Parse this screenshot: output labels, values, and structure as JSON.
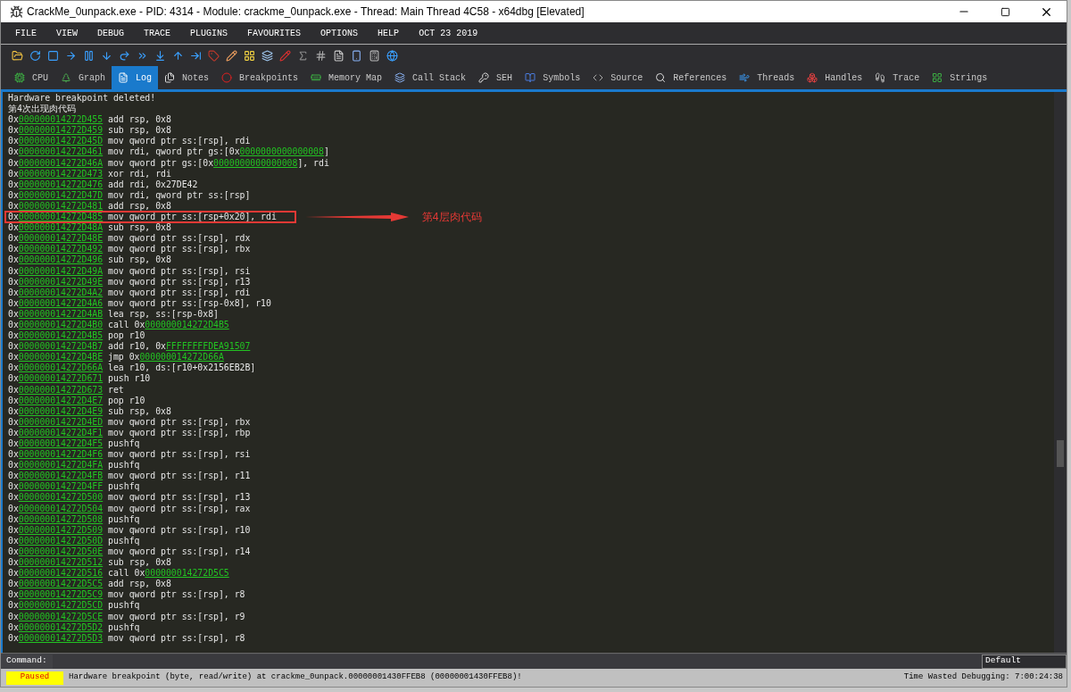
{
  "window": {
    "title": "CrackMe_0unpack.exe - PID: 4314 - Module: crackme_0unpack.exe - Thread: Main Thread 4C58 - x64dbg [Elevated]"
  },
  "menu": [
    "FILE",
    "VIEW",
    "DEBUG",
    "TRACE",
    "PLUGINS",
    "FAVOURITES",
    "OPTIONS",
    "HELP",
    "OCT 23 2019"
  ],
  "tabs": [
    {
      "label": "CPU",
      "selected": false
    },
    {
      "label": "Graph",
      "selected": false
    },
    {
      "label": "Log",
      "selected": true
    },
    {
      "label": "Notes",
      "selected": false
    },
    {
      "label": "Breakpoints",
      "selected": false
    },
    {
      "label": "Memory Map",
      "selected": false
    },
    {
      "label": "Call Stack",
      "selected": false
    },
    {
      "label": "SEH",
      "selected": false
    },
    {
      "label": "Symbols",
      "selected": false
    },
    {
      "label": "Source",
      "selected": false
    },
    {
      "label": "References",
      "selected": false
    },
    {
      "label": "Threads",
      "selected": false
    },
    {
      "label": "Handles",
      "selected": false
    },
    {
      "label": "Trace",
      "selected": false
    },
    {
      "label": "Strings",
      "selected": false
    }
  ],
  "log": {
    "lines": [
      {
        "parts": [
          {
            "kind": "plain",
            "text": "Hardware breakpoint deleted!"
          }
        ]
      },
      {
        "parts": [
          {
            "kind": "plain",
            "text": "第4次出现肉代码"
          }
        ]
      },
      {
        "parts": [
          {
            "kind": "plain",
            "text": "0x"
          },
          {
            "kind": "link",
            "text": "000000014272D455"
          },
          {
            "kind": "plain",
            "text": " add rsp, 0x8"
          }
        ]
      },
      {
        "parts": [
          {
            "kind": "plain",
            "text": "0x"
          },
          {
            "kind": "link",
            "text": "000000014272D459"
          },
          {
            "kind": "plain",
            "text": " sub rsp, 0x8"
          }
        ]
      },
      {
        "parts": [
          {
            "kind": "plain",
            "text": "0x"
          },
          {
            "kind": "link",
            "text": "000000014272D45D"
          },
          {
            "kind": "plain",
            "text": " mov qword ptr ss:[rsp], rdi"
          }
        ]
      },
      {
        "parts": [
          {
            "kind": "plain",
            "text": "0x"
          },
          {
            "kind": "link",
            "text": "000000014272D461"
          },
          {
            "kind": "plain",
            "text": " mov rdi, qword ptr gs:[0x"
          },
          {
            "kind": "link",
            "text": "0000000000000008"
          },
          {
            "kind": "plain",
            "text": "]"
          }
        ]
      },
      {
        "parts": [
          {
            "kind": "plain",
            "text": "0x"
          },
          {
            "kind": "link",
            "text": "000000014272D46A"
          },
          {
            "kind": "plain",
            "text": " mov qword ptr gs:[0x"
          },
          {
            "kind": "link",
            "text": "0000000000000008"
          },
          {
            "kind": "plain",
            "text": "], rdi"
          }
        ]
      },
      {
        "parts": [
          {
            "kind": "plain",
            "text": "0x"
          },
          {
            "kind": "link",
            "text": "000000014272D473"
          },
          {
            "kind": "plain",
            "text": " xor rdi, rdi"
          }
        ]
      },
      {
        "parts": [
          {
            "kind": "plain",
            "text": "0x"
          },
          {
            "kind": "link",
            "text": "000000014272D476"
          },
          {
            "kind": "plain",
            "text": " add rdi, 0x27DE42"
          }
        ]
      },
      {
        "parts": [
          {
            "kind": "plain",
            "text": "0x"
          },
          {
            "kind": "link",
            "text": "000000014272D47D"
          },
          {
            "kind": "plain",
            "text": " mov rdi, qword ptr ss:[rsp]"
          }
        ]
      },
      {
        "parts": [
          {
            "kind": "plain",
            "text": "0x"
          },
          {
            "kind": "link",
            "text": "000000014272D481"
          },
          {
            "kind": "plain",
            "text": " add rsp, 0x8"
          }
        ]
      },
      {
        "parts": [
          {
            "kind": "plain",
            "text": "0x"
          },
          {
            "kind": "link",
            "text": "000000014272D485"
          },
          {
            "kind": "plain",
            "text": " mov qword ptr ss:[rsp+0x20], rdi"
          }
        ],
        "highlighted": true,
        "annotation": "第4层肉代码"
      },
      {
        "parts": [
          {
            "kind": "plain",
            "text": "0x"
          },
          {
            "kind": "link",
            "text": "000000014272D48A"
          },
          {
            "kind": "plain",
            "text": " sub rsp, 0x8"
          }
        ]
      },
      {
        "parts": [
          {
            "kind": "plain",
            "text": "0x"
          },
          {
            "kind": "link",
            "text": "000000014272D48E"
          },
          {
            "kind": "plain",
            "text": " mov qword ptr ss:[rsp], rdx"
          }
        ]
      },
      {
        "parts": [
          {
            "kind": "plain",
            "text": "0x"
          },
          {
            "kind": "link",
            "text": "000000014272D492"
          },
          {
            "kind": "plain",
            "text": " mov qword ptr ss:[rsp], rbx"
          }
        ]
      },
      {
        "parts": [
          {
            "kind": "plain",
            "text": "0x"
          },
          {
            "kind": "link",
            "text": "000000014272D496"
          },
          {
            "kind": "plain",
            "text": " sub rsp, 0x8"
          }
        ]
      },
      {
        "parts": [
          {
            "kind": "plain",
            "text": "0x"
          },
          {
            "kind": "link",
            "text": "000000014272D49A"
          },
          {
            "kind": "plain",
            "text": " mov qword ptr ss:[rsp], rsi"
          }
        ]
      },
      {
        "parts": [
          {
            "kind": "plain",
            "text": "0x"
          },
          {
            "kind": "link",
            "text": "000000014272D49E"
          },
          {
            "kind": "plain",
            "text": " mov qword ptr ss:[rsp], r13"
          }
        ]
      },
      {
        "parts": [
          {
            "kind": "plain",
            "text": "0x"
          },
          {
            "kind": "link",
            "text": "000000014272D4A2"
          },
          {
            "kind": "plain",
            "text": " mov qword ptr ss:[rsp], rdi"
          }
        ]
      },
      {
        "parts": [
          {
            "kind": "plain",
            "text": "0x"
          },
          {
            "kind": "link",
            "text": "000000014272D4A6"
          },
          {
            "kind": "plain",
            "text": " mov qword ptr ss:[rsp-0x8], r10"
          }
        ]
      },
      {
        "parts": [
          {
            "kind": "plain",
            "text": "0x"
          },
          {
            "kind": "link",
            "text": "000000014272D4AB"
          },
          {
            "kind": "plain",
            "text": " lea rsp, ss:[rsp-0x8]"
          }
        ]
      },
      {
        "parts": [
          {
            "kind": "plain",
            "text": "0x"
          },
          {
            "kind": "link",
            "text": "000000014272D4B0"
          },
          {
            "kind": "plain",
            "text": " call 0x"
          },
          {
            "kind": "link",
            "text": "000000014272D4B5"
          }
        ]
      },
      {
        "parts": [
          {
            "kind": "plain",
            "text": "0x"
          },
          {
            "kind": "link",
            "text": "000000014272D4B5"
          },
          {
            "kind": "plain",
            "text": " pop r10"
          }
        ]
      },
      {
        "parts": [
          {
            "kind": "plain",
            "text": "0x"
          },
          {
            "kind": "link",
            "text": "000000014272D4B7"
          },
          {
            "kind": "plain",
            "text": " add r10, 0x"
          },
          {
            "kind": "link",
            "text": "FFFFFFFFDEA91507"
          }
        ]
      },
      {
        "parts": [
          {
            "kind": "plain",
            "text": "0x"
          },
          {
            "kind": "link",
            "text": "000000014272D4BE"
          },
          {
            "kind": "plain",
            "text": " jmp 0x"
          },
          {
            "kind": "link",
            "text": "000000014272D66A"
          }
        ]
      },
      {
        "parts": [
          {
            "kind": "plain",
            "text": "0x"
          },
          {
            "kind": "link",
            "text": "000000014272D66A"
          },
          {
            "kind": "plain",
            "text": " lea r10, ds:[r10+0x2156EB2B]"
          }
        ]
      },
      {
        "parts": [
          {
            "kind": "plain",
            "text": "0x"
          },
          {
            "kind": "link",
            "text": "000000014272D671"
          },
          {
            "kind": "plain",
            "text": " push r10"
          }
        ]
      },
      {
        "parts": [
          {
            "kind": "plain",
            "text": "0x"
          },
          {
            "kind": "link",
            "text": "000000014272D673"
          },
          {
            "kind": "plain",
            "text": " ret"
          }
        ]
      },
      {
        "parts": [
          {
            "kind": "plain",
            "text": "0x"
          },
          {
            "kind": "link",
            "text": "000000014272D4E7"
          },
          {
            "kind": "plain",
            "text": " pop r10"
          }
        ]
      },
      {
        "parts": [
          {
            "kind": "plain",
            "text": "0x"
          },
          {
            "kind": "link",
            "text": "000000014272D4E9"
          },
          {
            "kind": "plain",
            "text": " sub rsp, 0x8"
          }
        ]
      },
      {
        "parts": [
          {
            "kind": "plain",
            "text": "0x"
          },
          {
            "kind": "link",
            "text": "000000014272D4ED"
          },
          {
            "kind": "plain",
            "text": " mov qword ptr ss:[rsp], rbx"
          }
        ]
      },
      {
        "parts": [
          {
            "kind": "plain",
            "text": "0x"
          },
          {
            "kind": "link",
            "text": "000000014272D4F1"
          },
          {
            "kind": "plain",
            "text": " mov qword ptr ss:[rsp], rbp"
          }
        ]
      },
      {
        "parts": [
          {
            "kind": "plain",
            "text": "0x"
          },
          {
            "kind": "link",
            "text": "000000014272D4F5"
          },
          {
            "kind": "plain",
            "text": " pushfq"
          }
        ]
      },
      {
        "parts": [
          {
            "kind": "plain",
            "text": "0x"
          },
          {
            "kind": "link",
            "text": "000000014272D4F6"
          },
          {
            "kind": "plain",
            "text": " mov qword ptr ss:[rsp], rsi"
          }
        ]
      },
      {
        "parts": [
          {
            "kind": "plain",
            "text": "0x"
          },
          {
            "kind": "link",
            "text": "000000014272D4FA"
          },
          {
            "kind": "plain",
            "text": " pushfq"
          }
        ]
      },
      {
        "parts": [
          {
            "kind": "plain",
            "text": "0x"
          },
          {
            "kind": "link",
            "text": "000000014272D4FB"
          },
          {
            "kind": "plain",
            "text": " mov qword ptr ss:[rsp], r11"
          }
        ]
      },
      {
        "parts": [
          {
            "kind": "plain",
            "text": "0x"
          },
          {
            "kind": "link",
            "text": "000000014272D4FF"
          },
          {
            "kind": "plain",
            "text": " pushfq"
          }
        ]
      },
      {
        "parts": [
          {
            "kind": "plain",
            "text": "0x"
          },
          {
            "kind": "link",
            "text": "000000014272D500"
          },
          {
            "kind": "plain",
            "text": " mov qword ptr ss:[rsp], r13"
          }
        ]
      },
      {
        "parts": [
          {
            "kind": "plain",
            "text": "0x"
          },
          {
            "kind": "link",
            "text": "000000014272D504"
          },
          {
            "kind": "plain",
            "text": " mov qword ptr ss:[rsp], rax"
          }
        ]
      },
      {
        "parts": [
          {
            "kind": "plain",
            "text": "0x"
          },
          {
            "kind": "link",
            "text": "000000014272D508"
          },
          {
            "kind": "plain",
            "text": " pushfq"
          }
        ]
      },
      {
        "parts": [
          {
            "kind": "plain",
            "text": "0x"
          },
          {
            "kind": "link",
            "text": "000000014272D509"
          },
          {
            "kind": "plain",
            "text": " mov qword ptr ss:[rsp], r10"
          }
        ]
      },
      {
        "parts": [
          {
            "kind": "plain",
            "text": "0x"
          },
          {
            "kind": "link",
            "text": "000000014272D50D"
          },
          {
            "kind": "plain",
            "text": " pushfq"
          }
        ]
      },
      {
        "parts": [
          {
            "kind": "plain",
            "text": "0x"
          },
          {
            "kind": "link",
            "text": "000000014272D50E"
          },
          {
            "kind": "plain",
            "text": " mov qword ptr ss:[rsp], r14"
          }
        ]
      },
      {
        "parts": [
          {
            "kind": "plain",
            "text": "0x"
          },
          {
            "kind": "link",
            "text": "000000014272D512"
          },
          {
            "kind": "plain",
            "text": " sub rsp, 0x8"
          }
        ]
      },
      {
        "parts": [
          {
            "kind": "plain",
            "text": "0x"
          },
          {
            "kind": "link",
            "text": "000000014272D516"
          },
          {
            "kind": "plain",
            "text": " call 0x"
          },
          {
            "kind": "link",
            "text": "000000014272D5C5"
          }
        ]
      },
      {
        "parts": [
          {
            "kind": "plain",
            "text": "0x"
          },
          {
            "kind": "link",
            "text": "000000014272D5C5"
          },
          {
            "kind": "plain",
            "text": " add rsp, 0x8"
          }
        ]
      },
      {
        "parts": [
          {
            "kind": "plain",
            "text": "0x"
          },
          {
            "kind": "link",
            "text": "000000014272D5C9"
          },
          {
            "kind": "plain",
            "text": " mov qword ptr ss:[rsp], r8"
          }
        ]
      },
      {
        "parts": [
          {
            "kind": "plain",
            "text": "0x"
          },
          {
            "kind": "link",
            "text": "000000014272D5CD"
          },
          {
            "kind": "plain",
            "text": " pushfq"
          }
        ]
      },
      {
        "parts": [
          {
            "kind": "plain",
            "text": "0x"
          },
          {
            "kind": "link",
            "text": "000000014272D5CE"
          },
          {
            "kind": "plain",
            "text": " mov qword ptr ss:[rsp], r9"
          }
        ]
      },
      {
        "parts": [
          {
            "kind": "plain",
            "text": "0x"
          },
          {
            "kind": "link",
            "text": "000000014272D5D2"
          },
          {
            "kind": "plain",
            "text": " pushfq"
          }
        ]
      },
      {
        "parts": [
          {
            "kind": "plain",
            "text": "0x"
          },
          {
            "kind": "link",
            "text": "000000014272D5D3"
          },
          {
            "kind": "plain",
            "text": " mov qword ptr ss:[rsp], r8"
          }
        ]
      }
    ]
  },
  "command": {
    "label": "Command:",
    "mode": "Default"
  },
  "status_bar": {
    "state": "Paused",
    "message": "Hardware breakpoint (byte, read/write) at crackme_0unpack.00000001430FFEB8 (00000001430FFEB8)!",
    "timer": "Time Wasted Debugging: 7:00:24:38"
  }
}
